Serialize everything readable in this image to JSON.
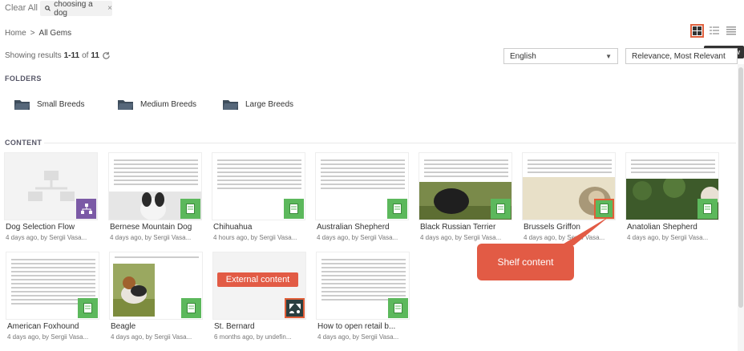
{
  "topbar": {
    "clear_all": "Clear All",
    "search_chip": "choosing a dog",
    "chip_close": "×"
  },
  "breadcrumb": {
    "home": "Home",
    "separator": ">",
    "current": "All Gems"
  },
  "view": {
    "tooltip": "Card view"
  },
  "results": {
    "prefix": "Showing results",
    "range": "1-11",
    "of": "of",
    "total": "11"
  },
  "filters": {
    "language": "English",
    "sort": "Relevance, Most Relevant"
  },
  "sections": {
    "folders": "FOLDERS",
    "content": "CONTENT"
  },
  "folders": [
    {
      "label": "Small Breeds"
    },
    {
      "label": "Medium Breeds"
    },
    {
      "label": "Large Breeds"
    }
  ],
  "cards": [
    {
      "title": "Dog Selection Flow",
      "meta": "4 days ago, by Sergii Vasa..."
    },
    {
      "title": "Bernese Mountain Dog",
      "meta": "4 days ago, by Sergii Vasa..."
    },
    {
      "title": "Chihuahua",
      "meta": "4 hours ago, by Sergii Vasa..."
    },
    {
      "title": "Australian Shepherd",
      "meta": "4 days ago, by Sergii Vasa..."
    },
    {
      "title": "Black Russian Terrier",
      "meta": "4 days ago, by Sergii Vasa..."
    },
    {
      "title": "Brussels Griffon",
      "meta": "4 days ago, by Sergii Vasa..."
    },
    {
      "title": "Anatolian Shepherd",
      "meta": "4 days ago, by Sergii Vasa..."
    },
    {
      "title": "American Foxhound",
      "meta": "4 days ago, by Sergii Vasa..."
    },
    {
      "title": "Beagle",
      "meta": "4 days ago, by Sergii Vasa..."
    },
    {
      "title": "St. Bernard",
      "meta": "6 months ago, by undefin..."
    },
    {
      "title": "How to open retail b...",
      "meta": "4 days ago, by Sergii Vasa..."
    }
  ],
  "callouts": {
    "shelf": "Shelf content",
    "external": "External content"
  },
  "colors": {
    "accent": "#e25b45",
    "badge_green": "#5cb85c",
    "badge_purple": "#7b5aa6",
    "zendesk": "#2a3f40"
  }
}
